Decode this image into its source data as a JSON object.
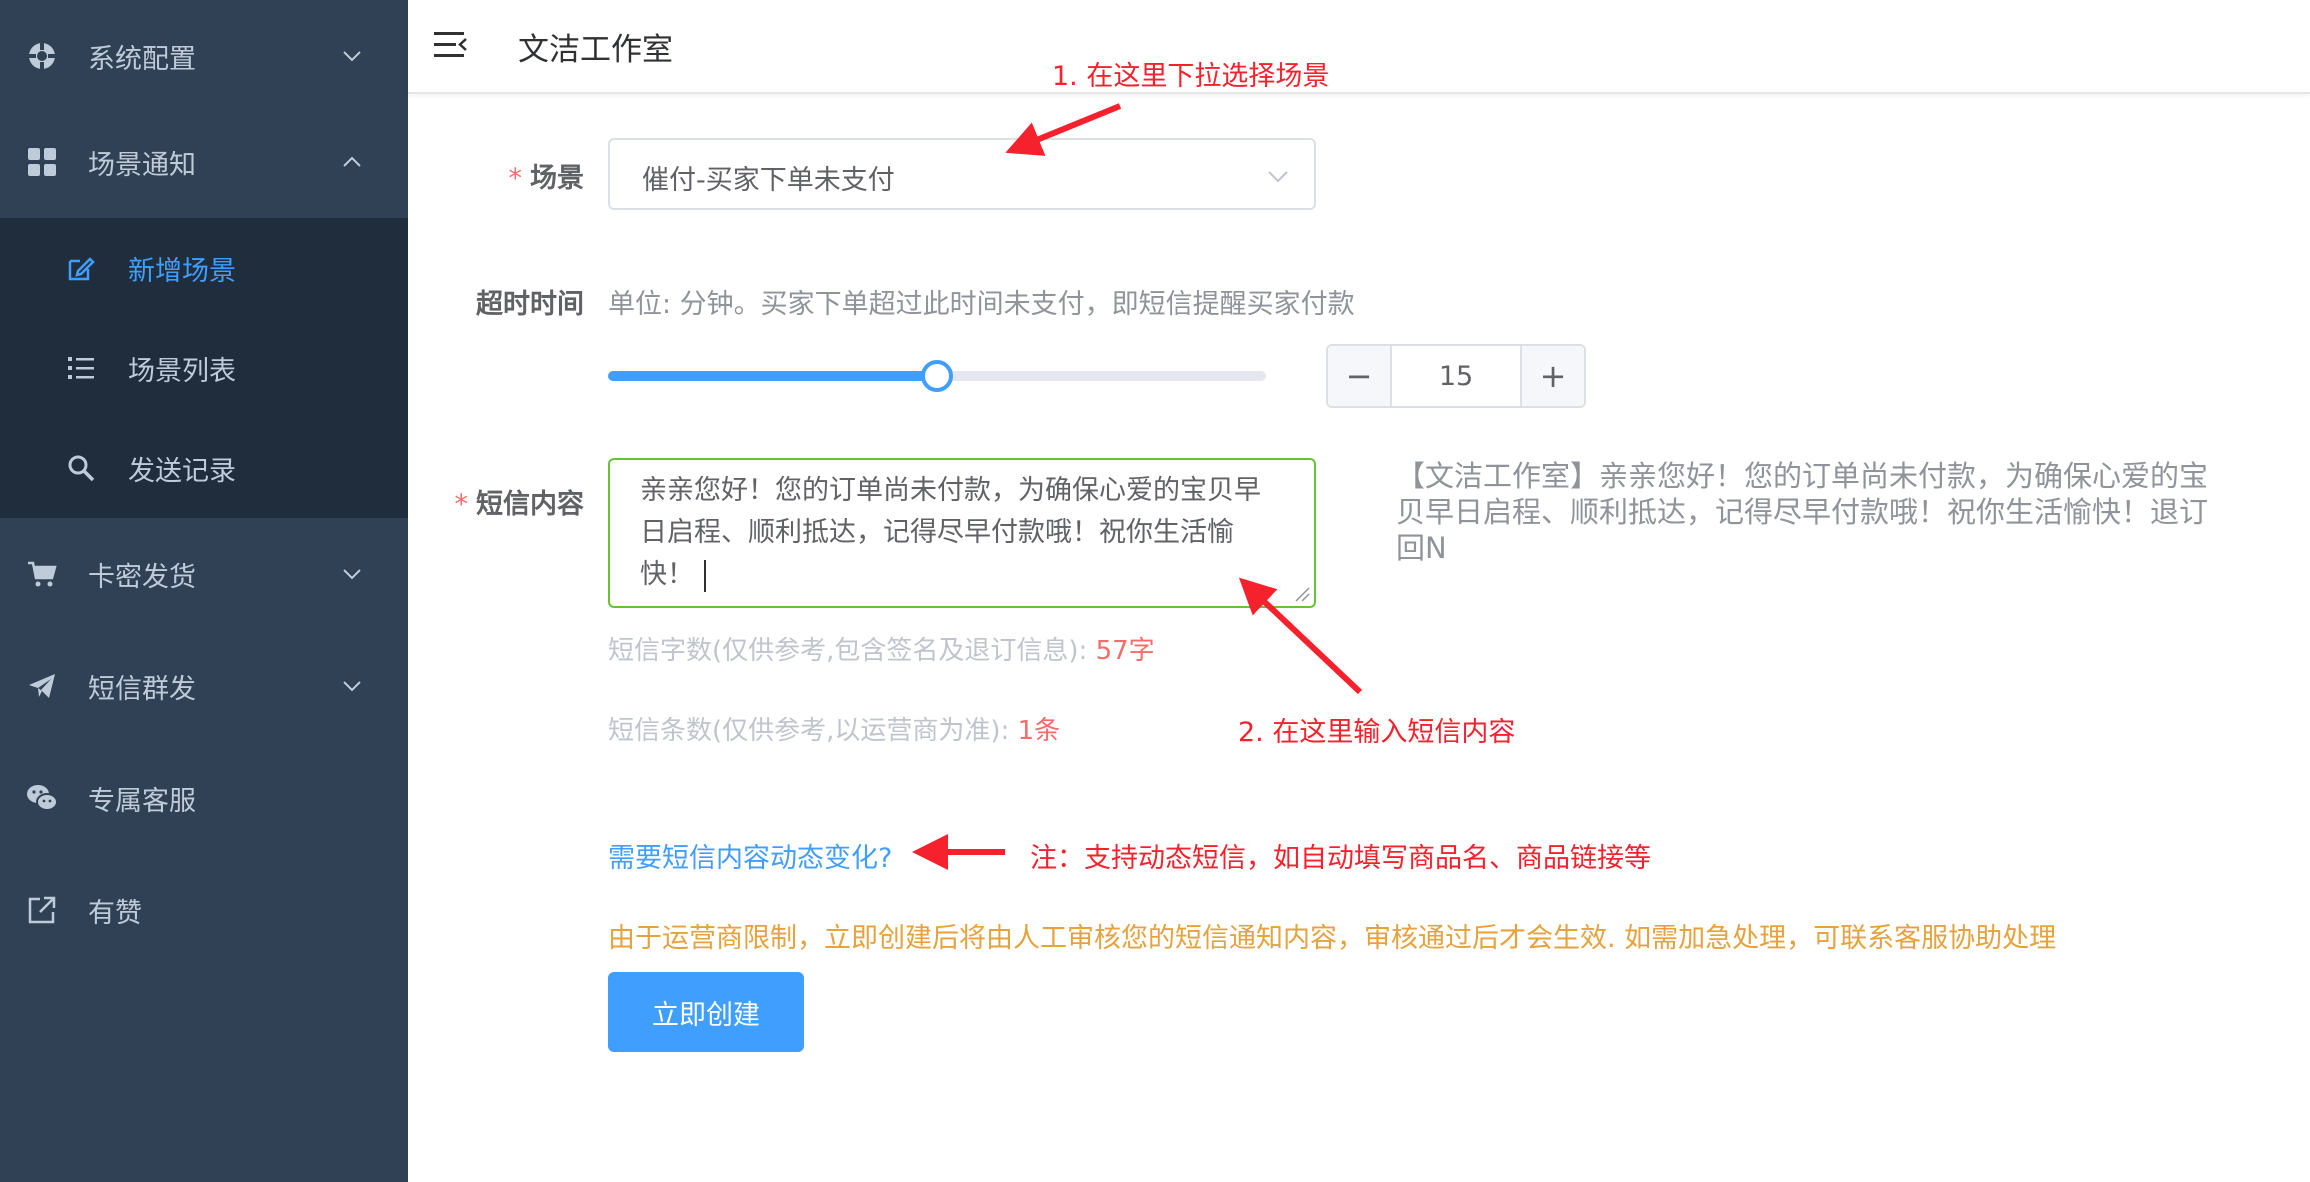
{
  "app": {
    "title": "文洁工作室"
  },
  "sidebar": {
    "items": [
      {
        "label": "系统配置",
        "icon": "settings-wheel-icon"
      },
      {
        "label": "场景通知",
        "icon": "grid-icon"
      },
      {
        "label": "卡密发货",
        "icon": "cart-icon"
      },
      {
        "label": "短信群发",
        "icon": "paper-plane-icon"
      },
      {
        "label": "专属客服",
        "icon": "wechat-icon"
      },
      {
        "label": "有赞",
        "icon": "external-link-icon"
      }
    ],
    "subitems": [
      {
        "label": "新增场景",
        "icon": "edit-icon"
      },
      {
        "label": "场景列表",
        "icon": "list-icon"
      },
      {
        "label": "发送记录",
        "icon": "search-icon"
      }
    ]
  },
  "form": {
    "scene_label": "场景",
    "scene_value": "催付-买家下单未支付",
    "timeout_label": "超时时间",
    "timeout_hint": "单位: 分钟。买家下单超过此时间未支付，即短信提醒买家付款",
    "timeout_value": 15,
    "timeout_max": 30,
    "stepper_value": "15",
    "minus": "−",
    "plus": "+",
    "content_label": "短信内容",
    "content_value": "亲亲您好！您的订单尚未付款，为确保心爱的宝贝早日启程、顺利抵达，记得尽早付款哦！祝你生活愉快！",
    "preview": "【文洁工作室】亲亲您好！您的订单尚未付款，为确保心爱的宝贝早日启程、顺利抵达，记得尽早付款哦！祝你生活愉快！退订回N",
    "char_count_label": "短信字数(仅供参考,包含签名及退订信息): ",
    "char_count_value": "57字",
    "msg_count_label": "短信条数(仅供参考,以运营商为准): ",
    "msg_count_value": "1条",
    "dynamic_link": "需要短信内容动态变化?",
    "warning": "由于运营商限制，立即创建后将由人工审核您的短信通知内容，审核通过后才会生效. 如需加急处理，可联系客服协助处理",
    "submit": "立即创建"
  },
  "annotations": {
    "a1": "1. 在这里下拉选择场景",
    "a2": "2. 在这里输入短信内容",
    "a3": "注：支持动态短信，如自动填写商品名、商品链接等"
  },
  "colors": {
    "sidebar_bg": "#304156",
    "submenu_bg": "#1f2d3d",
    "primary": "#409eff",
    "annotation": "#f5222d",
    "warning": "#e6a23c"
  }
}
